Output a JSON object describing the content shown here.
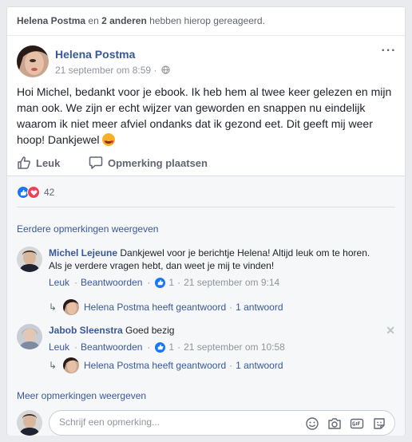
{
  "reacted": {
    "name": "Helena Postma",
    "connector": "en",
    "others": "2 anderen",
    "suffix": "hebben hierop gereageerd."
  },
  "post": {
    "author": "Helena Postma",
    "timestamp": "21 september om 8:59 ·",
    "text": "Hoi Michel, bedankt voor je ebook. Ik heb hem al twee keer gelezen en mijn man ook. We zijn er echt wijzer van geworden en snappen nu eindelijk waarom ik niet meer afviel ondanks dat ik gezond eet. Dit geeft mij weer hoop! Dankjewel",
    "more_icon": "more-horizontal-icon",
    "privacy_icon": "globe-icon"
  },
  "actions": {
    "like": "Leuk",
    "comment": "Opmerking plaatsen"
  },
  "reactions": {
    "count": "42",
    "types": [
      "like",
      "love"
    ],
    "like_color": "#1877f2",
    "love_color": "#f33e58"
  },
  "comments_section": {
    "previous": "Eerdere opmerkingen weergeven",
    "more": "Meer opmerkingen weergeven",
    "items": [
      {
        "name": "Michel Lejeune",
        "text": "Dankjewel voor je berichtje Helena! Altijd leuk om te horen. Als je verdere vragen hebt, dan weet je mij te vinden!",
        "like": "Leuk",
        "reply": "Beantwoorden",
        "like_count": "1",
        "time": "21 september om 9:14",
        "reply_summary": "Helena Postma heeft geantwoord",
        "reply_count": "1 antwoord"
      },
      {
        "name": "Jabob Sleenstra",
        "text": "Goed bezig",
        "like": "Leuk",
        "reply": "Beantwoorden",
        "like_count": "1",
        "time": "21 september om 10:58",
        "reply_summary": "Helena Postma heeft geantwoord",
        "reply_count": "1 antwoord"
      }
    ]
  },
  "composer": {
    "placeholder": "Schrijf een opmerking...",
    "icons": [
      "emoji-icon",
      "camera-icon",
      "gif-icon",
      "sticker-icon"
    ]
  },
  "colors": {
    "link": "#385898",
    "muted": "#90949c",
    "background": "#e9ebee"
  }
}
